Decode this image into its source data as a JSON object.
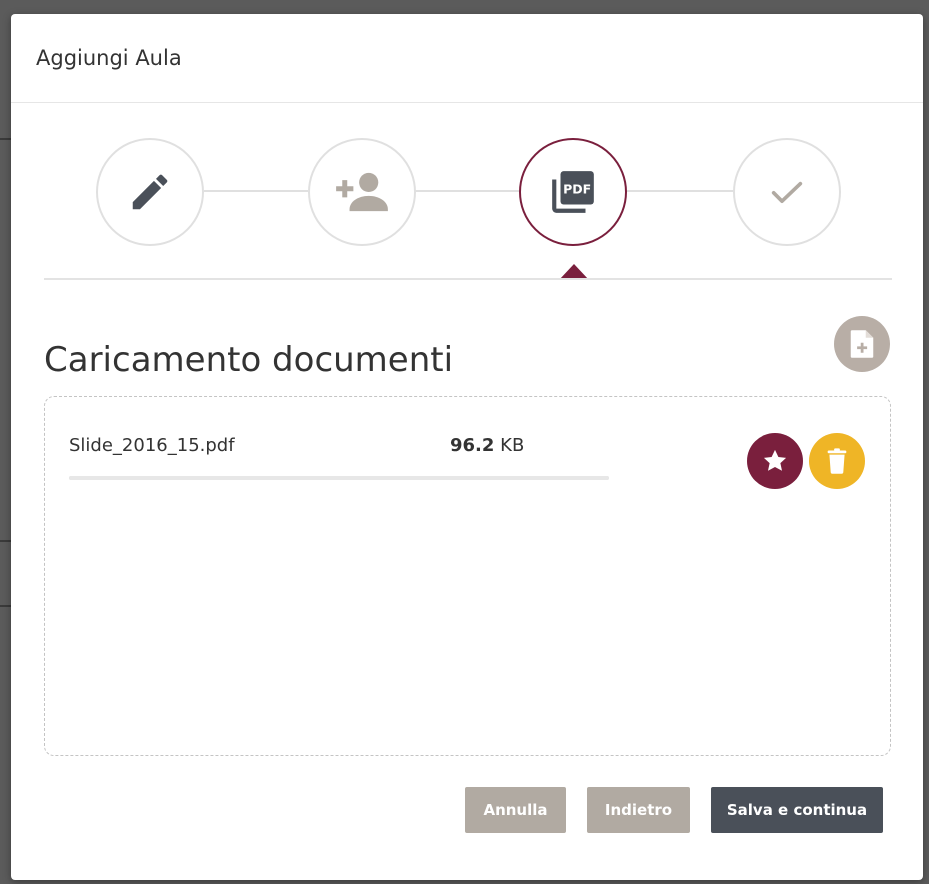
{
  "dialog": {
    "title": "Aggiungi Aula"
  },
  "stepper": {
    "steps": [
      {
        "icon": "pencil-icon",
        "state": "completed"
      },
      {
        "icon": "add-user-icon",
        "state": "pending"
      },
      {
        "icon": "pdf-documents-icon",
        "state": "active"
      },
      {
        "icon": "checkmark-icon",
        "state": "pending"
      }
    ],
    "active_step": 3
  },
  "section": {
    "title": "Caricamento documenti",
    "add_icon": "add-file-icon"
  },
  "files": [
    {
      "name": "Slide_2016_15.pdf",
      "size_value": "96.2",
      "size_unit": "KB",
      "progress": 1.0
    }
  ],
  "buttons": {
    "cancel": "Annulla",
    "back": "Indietro",
    "save": "Salva e continua"
  },
  "colors": {
    "accent": "#7a1f3d",
    "warning": "#efb526",
    "muted_button": "#b1aaa2",
    "primary_button": "#4a5059"
  }
}
